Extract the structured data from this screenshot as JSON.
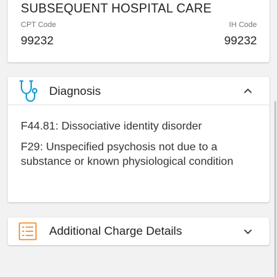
{
  "procedure": {
    "title": "SUBSEQUENT HOSPITAL CARE",
    "cpt_label": "CPT Code",
    "cpt_value": "99232",
    "ih_label": "IH Code",
    "ih_value": "99232"
  },
  "diagnosis": {
    "title": "Diagnosis",
    "icon": "stethoscope-icon",
    "items": [
      "F44.81: Dissociative identity disorder",
      "F29: Unspecified psychosis not due to a substance or known physiological condition"
    ]
  },
  "additional_charges": {
    "title": "Additional Charge Details",
    "icon": "list-icon"
  },
  "colors": {
    "accent_diagnosis": "#1a9bd7",
    "accent_additional": "#f08a24"
  }
}
